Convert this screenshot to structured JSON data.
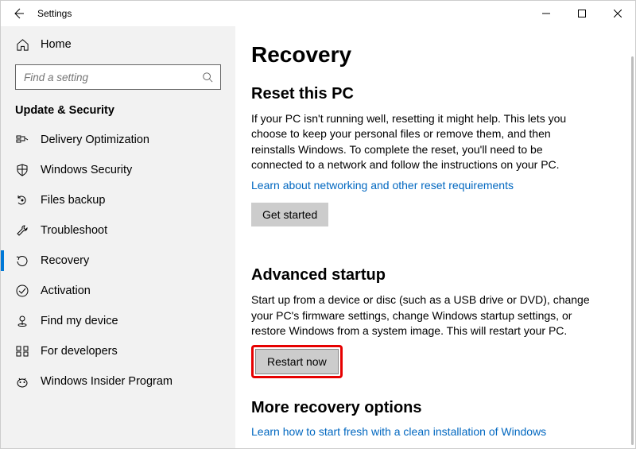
{
  "window": {
    "title": "Settings"
  },
  "sidebar": {
    "home": "Home",
    "search_placeholder": "Find a setting",
    "group": "Update & Security",
    "items": [
      {
        "label": "Delivery Optimization"
      },
      {
        "label": "Windows Security"
      },
      {
        "label": "Files backup"
      },
      {
        "label": "Troubleshoot"
      },
      {
        "label": "Recovery"
      },
      {
        "label": "Activation"
      },
      {
        "label": "Find my device"
      },
      {
        "label": "For developers"
      },
      {
        "label": "Windows Insider Program"
      }
    ]
  },
  "main": {
    "title": "Recovery",
    "reset": {
      "heading": "Reset this PC",
      "text": "If your PC isn't running well, resetting it might help. This lets you choose to keep your personal files or remove them, and then reinstalls Windows. To complete the reset, you'll need to be connected to a network and follow the instructions on your PC.",
      "link": "Learn about networking and other reset requirements",
      "button": "Get started"
    },
    "advanced": {
      "heading": "Advanced startup",
      "text": "Start up from a device or disc (such as a USB drive or DVD), change your PC's firmware settings, change Windows startup settings, or restore Windows from a system image. This will restart your PC.",
      "button": "Restart now"
    },
    "more": {
      "heading": "More recovery options",
      "link": "Learn how to start fresh with a clean installation of Windows"
    }
  }
}
